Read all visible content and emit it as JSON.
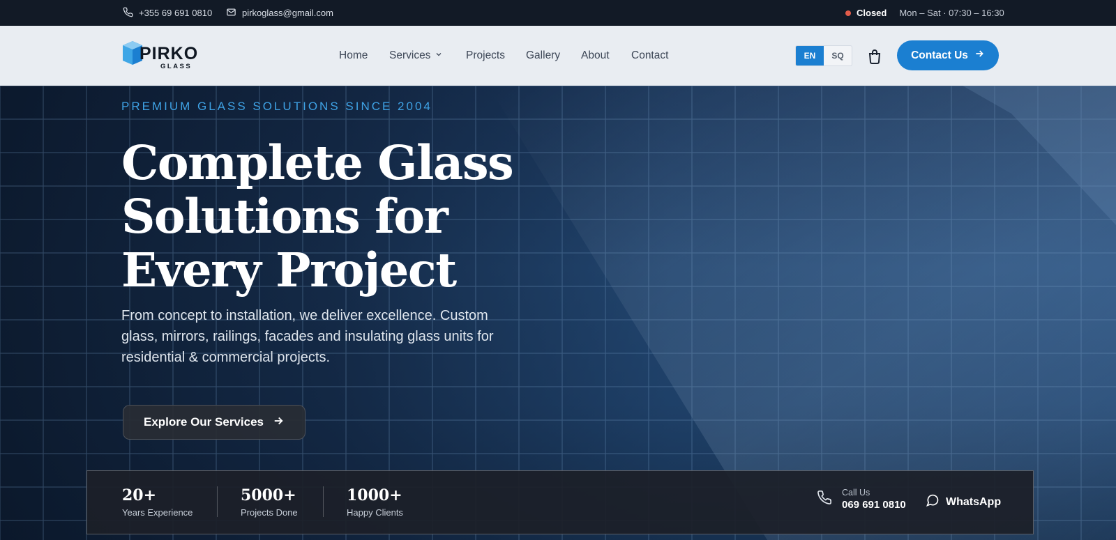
{
  "topbar": {
    "phone": "+355 69 691 0810",
    "email": "pirkoglass@gmail.com",
    "status": "Closed",
    "hours": "Mon – Sat · 07:30 – 16:30"
  },
  "brand": {
    "name": "PIRKO",
    "sub": "GLASS",
    "color": "#1b7fd1"
  },
  "nav": {
    "items": [
      {
        "label": "Home"
      },
      {
        "label": "Services"
      },
      {
        "label": "Projects"
      },
      {
        "label": "Gallery"
      },
      {
        "label": "About"
      },
      {
        "label": "Contact"
      }
    ]
  },
  "lang": {
    "active": "EN",
    "other": "SQ"
  },
  "header": {
    "contact_label": "Contact Us"
  },
  "hero": {
    "eyebrow": "PREMIUM GLASS SOLUTIONS SINCE 2004",
    "title_lines": [
      "Complete Glass",
      "Solutions for",
      "Every Project"
    ],
    "lead": "From concept to installation, we deliver excellence. Custom glass, mirrors, railings, facades and insulating glass units for residential & commercial projects.",
    "cta_label": "Explore Our Services"
  },
  "stats": {
    "items": [
      {
        "value": "20+",
        "label": "Years Experience"
      },
      {
        "value": "5000+",
        "label": "Projects Done"
      },
      {
        "value": "1000+",
        "label": "Happy Clients"
      }
    ],
    "call_label": "Call Us",
    "call_number": "069 691 0810",
    "whatsapp_label": "WhatsApp"
  },
  "icons": [
    "phone-icon",
    "mail-icon",
    "chevron-down-icon",
    "cart-icon",
    "arrow-right-icon",
    "whatsapp-icon"
  ]
}
